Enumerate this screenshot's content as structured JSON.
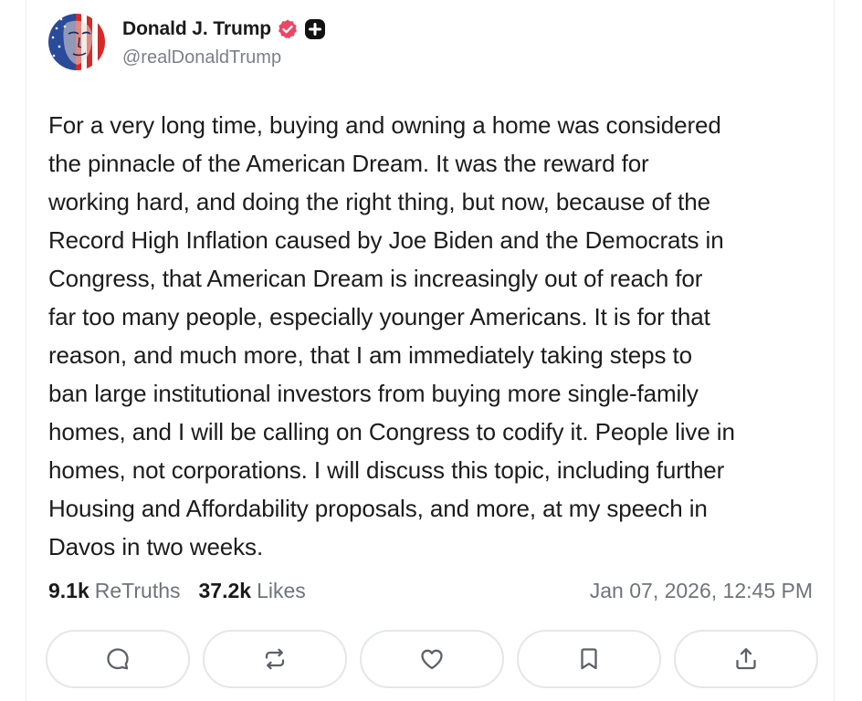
{
  "post": {
    "author": {
      "name": "Donald J. Trump",
      "handle": "@realDonaldTrump",
      "verified_color": "#ee4466"
    },
    "text_lines": [
      "For a very long time, buying and owning a home was considered",
      "the pinnacle of the American Dream. It was the reward for",
      "working hard, and doing the right thing, but now, because of the",
      "Record High Inflation caused by Joe Biden and the Democrats in",
      "Congress, that American Dream is increasingly out of reach for",
      "far too many people, especially younger Americans. It is for that",
      "reason, and much more, that I am immediately taking steps to",
      "ban large institutional investors from buying more single-family",
      "homes, and I will be calling on Congress to codify it. People live in",
      "homes, not corporations. I will discuss this topic, including further",
      "Housing and Affordability proposals, and more, at my speech in",
      "Davos in two weeks."
    ],
    "stats": {
      "retruths_count": "9.1k",
      "retruths_label": "ReTruths",
      "likes_count": "37.2k",
      "likes_label": "Likes"
    },
    "timestamp": "Jan 07, 2026, 12:45 PM"
  },
  "actions": [
    {
      "name": "reply",
      "icon": "comment-icon"
    },
    {
      "name": "retruth",
      "icon": "repost-icon"
    },
    {
      "name": "like",
      "icon": "heart-icon"
    },
    {
      "name": "bookmark",
      "icon": "bookmark-icon"
    },
    {
      "name": "share",
      "icon": "share-icon"
    }
  ],
  "colors": {
    "text": "#1c1c1c",
    "muted": "#6f737b",
    "border": "#e4e6ea",
    "icon": "#5c6068"
  }
}
